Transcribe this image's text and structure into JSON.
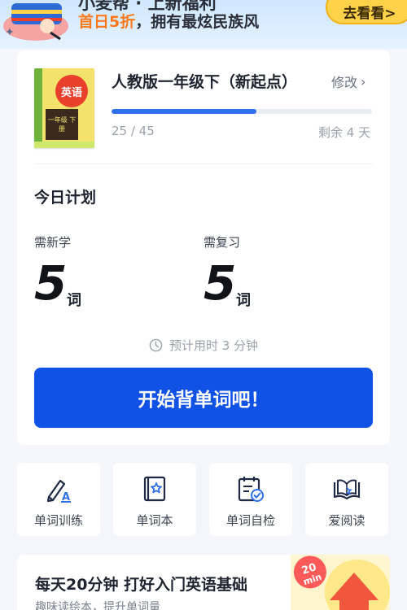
{
  "banner": {
    "line1": "小麦帮 · 上新福利",
    "highlight": "首日5折",
    "rest": "，拥有最炫民族风",
    "cta_label": "去看看>"
  },
  "book": {
    "cover_title": "英语",
    "cover_grade": "一年级 下册",
    "title": "人教版一年级下（新起点）",
    "edit_label": "修改",
    "progress_fraction": 0.556,
    "progress_text": "25 / 45",
    "days_left": "剩余 4 天"
  },
  "plan": {
    "title": "今日计划",
    "new_label": "需新学",
    "new_count": "5",
    "review_label": "需复习",
    "review_count": "5",
    "unit": "词",
    "estimate": "预计用时 3 分钟",
    "start_label": "开始背单词吧！"
  },
  "tools": [
    {
      "label": "单词训练",
      "icon": "pen-a-icon"
    },
    {
      "label": "单词本",
      "icon": "star-book-icon"
    },
    {
      "label": "单词自检",
      "icon": "calendar-check-icon"
    },
    {
      "label": "爱阅读",
      "icon": "open-book-icon"
    }
  ],
  "promo": {
    "title": "每天20分钟 打好入门英语基础",
    "subtitle": "趣味读绘本，提升单词量",
    "badge_top": "20",
    "badge_bottom": "min"
  },
  "colors": {
    "accent": "#1152e6",
    "progress": "#2f6fea",
    "banner_cta": "#ffd24a",
    "highlight": "#ff7a1a"
  }
}
